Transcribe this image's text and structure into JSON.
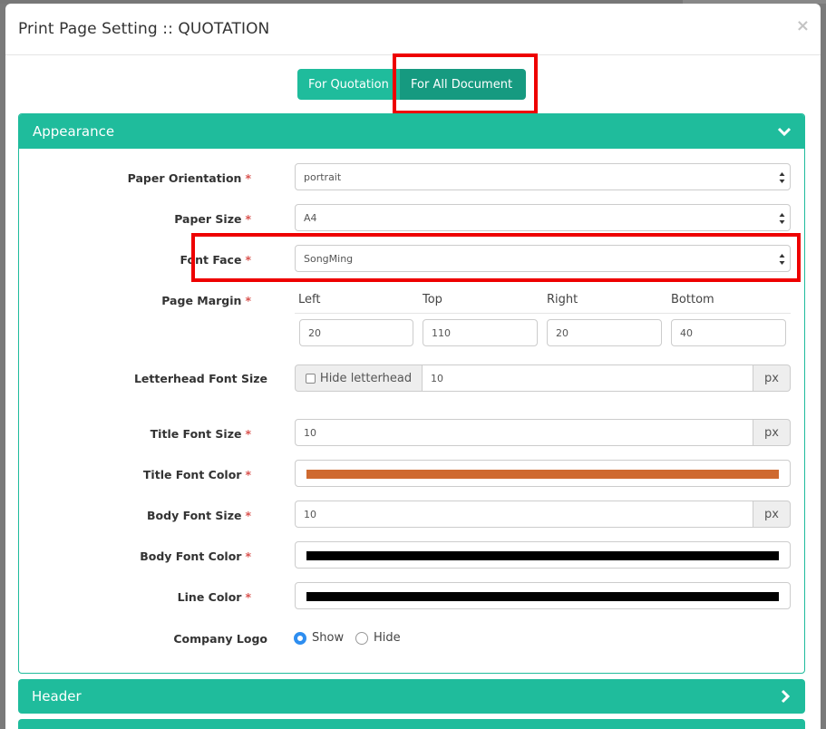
{
  "modal": {
    "title": "Print Page Setting :: QUOTATION",
    "close_glyph": "×"
  },
  "scope_tabs": [
    {
      "label": "For Quotation",
      "active": false
    },
    {
      "label": "For All Document",
      "active": true
    }
  ],
  "appearance": {
    "heading": "Appearance",
    "paper_orientation": {
      "label": "Paper Orientation",
      "value": "portrait"
    },
    "paper_size": {
      "label": "Paper Size",
      "value": "A4"
    },
    "font_face": {
      "label": "Font Face",
      "value": "SongMing"
    },
    "page_margin": {
      "label": "Page Margin",
      "left_label": "Left",
      "left": "20",
      "top_label": "Top",
      "top": "110",
      "right_label": "Right",
      "right": "20",
      "bottom_label": "Bottom",
      "bottom": "40"
    },
    "letterhead_font_size": {
      "label": "Letterhead Font Size",
      "hide_label": "Hide letterhead",
      "hide_checked": false,
      "value": "10",
      "unit": "px"
    },
    "title_font_size": {
      "label": "Title Font Size",
      "value": "10",
      "unit": "px"
    },
    "title_font_color": {
      "label": "Title Font Color",
      "color": "#cf6a30"
    },
    "body_font_size": {
      "label": "Body Font Size",
      "value": "10",
      "unit": "px"
    },
    "body_font_color": {
      "label": "Body Font Color",
      "color": "#000000"
    },
    "line_color": {
      "label": "Line Color",
      "color": "#000000"
    },
    "company_logo": {
      "label": "Company Logo",
      "show_label": "Show",
      "hide_label": "Hide",
      "selected": "Show"
    },
    "required_mark": "*"
  },
  "sections": [
    {
      "heading": "Header",
      "collapsed": true
    }
  ],
  "colors": {
    "accent": "#1fbc9c",
    "accent_dark": "#169a80",
    "highlight": "#ee0000",
    "required": "#d9534f",
    "radio_selected": "#2e8ef0"
  }
}
